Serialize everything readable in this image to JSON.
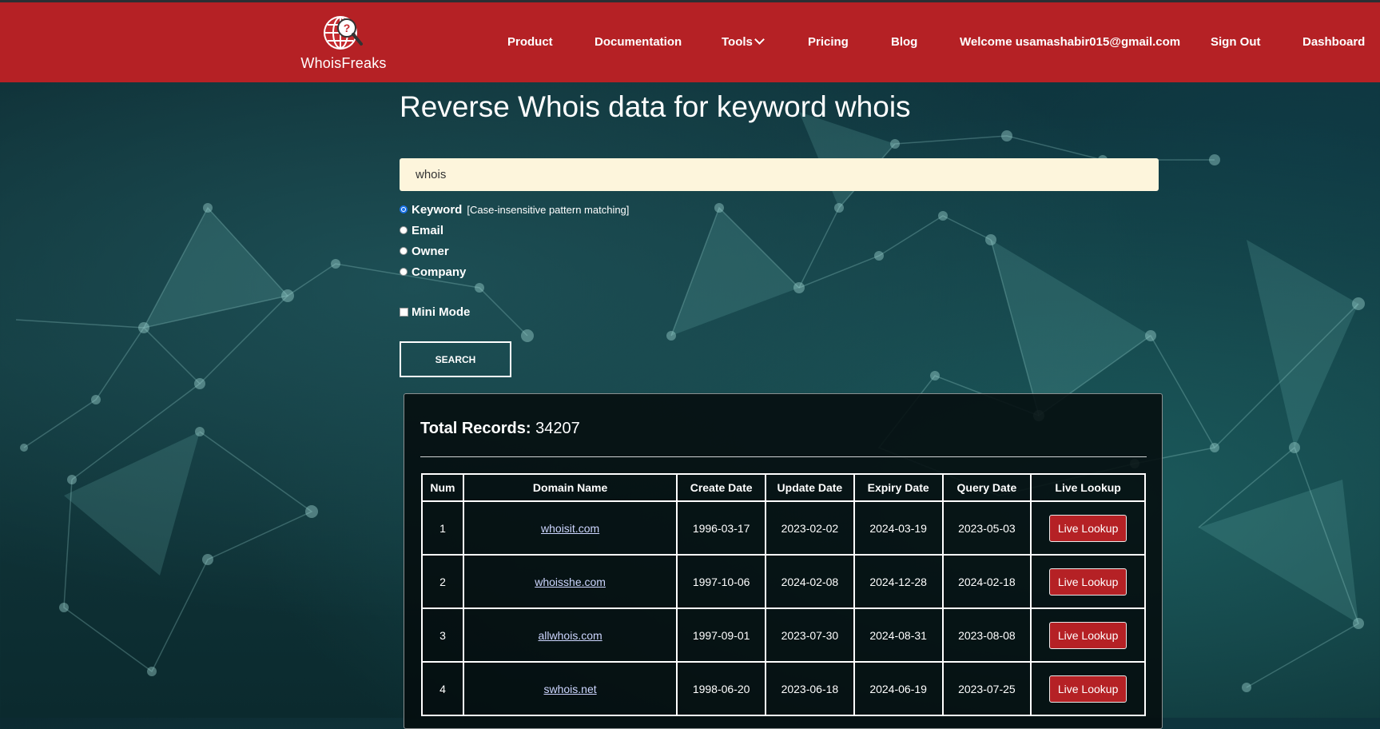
{
  "header": {
    "logo_text": "WhoisFreaks",
    "nav": {
      "product": "Product",
      "documentation": "Documentation",
      "tools": "Tools",
      "pricing": "Pricing",
      "blog": "Blog",
      "welcome": "Welcome usamashabir015@gmail.com",
      "sign_out": "Sign Out",
      "dashboard": "Dashboard"
    }
  },
  "page": {
    "title": "Reverse Whois data for keyword whois"
  },
  "search": {
    "value": "whois",
    "options": {
      "keyword": "Keyword",
      "keyword_hint": "[Case-insensitive pattern matching]",
      "email": "Email",
      "owner": "Owner",
      "company": "Company"
    },
    "selected": "Keyword",
    "mini_mode": "Mini Mode",
    "button": "SEARCH"
  },
  "results": {
    "total_label": "Total Records:",
    "total_value": "34207",
    "columns": {
      "num": "Num",
      "domain": "Domain Name",
      "create": "Create Date",
      "update": "Update Date",
      "expiry": "Expiry Date",
      "query": "Query Date",
      "live": "Live Lookup"
    },
    "rows": [
      {
        "num": "1",
        "domain": "whoisit.com",
        "create": "1996-03-17",
        "update": "2023-02-02",
        "expiry": "2024-03-19",
        "query": "2023-05-03",
        "action": "Live Lookup"
      },
      {
        "num": "2",
        "domain": "whoisshe.com",
        "create": "1997-10-06",
        "update": "2024-02-08",
        "expiry": "2024-12-28",
        "query": "2024-02-18",
        "action": "Live Lookup"
      },
      {
        "num": "3",
        "domain": "allwhois.com",
        "create": "1997-09-01",
        "update": "2023-07-30",
        "expiry": "2024-08-31",
        "query": "2023-08-08",
        "action": "Live Lookup"
      },
      {
        "num": "4",
        "domain": "swhois.net",
        "create": "1998-06-20",
        "update": "2023-06-18",
        "expiry": "2024-06-19",
        "query": "2023-07-25",
        "action": "Live Lookup"
      }
    ]
  },
  "colors": {
    "header_bg": "#b52125",
    "input_bg": "#fdf5dc",
    "button_red": "#b52125",
    "link": "#cdd6ff"
  }
}
